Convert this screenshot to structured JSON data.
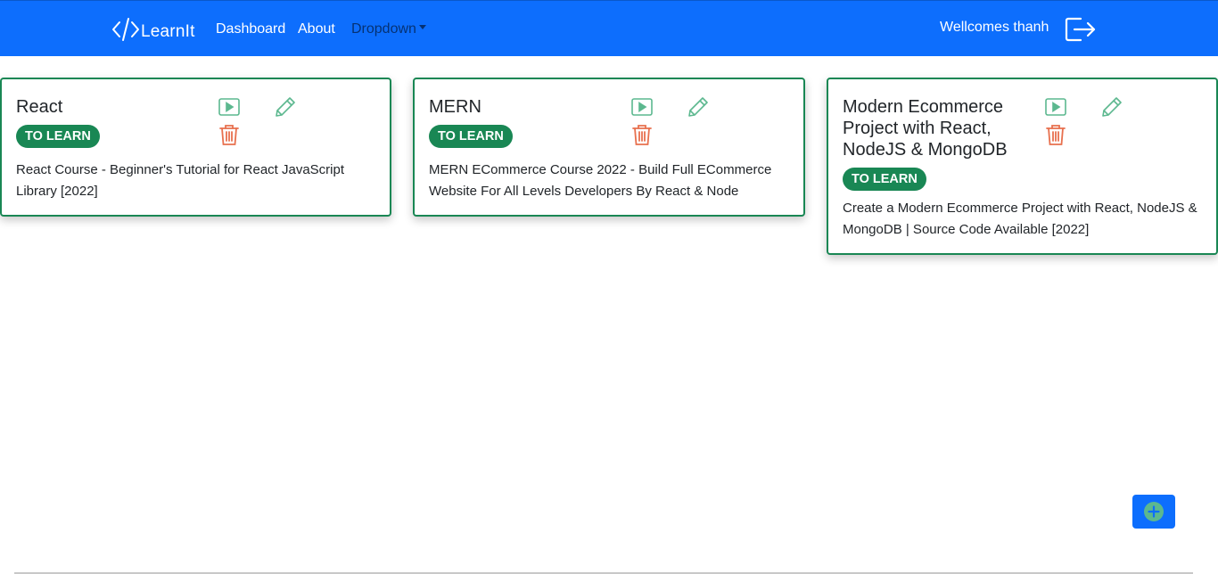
{
  "navbar": {
    "brand": "LearnIt",
    "links": [
      {
        "label": "Dashboard"
      },
      {
        "label": "About"
      },
      {
        "label": "Dropdown"
      }
    ],
    "welcome": "Wellcomes thanh"
  },
  "cards": [
    {
      "title": "React",
      "badge": "TO LEARN",
      "description": "React Course - Beginner's Tutorial for React JavaScript Library [2022]"
    },
    {
      "title": "MERN",
      "badge": "TO LEARN",
      "description": "MERN ECommerce Course 2022 - Build Full ECommerce Website For All Levels Developers By React & Node"
    },
    {
      "title": "Modern Ecommerce Project with React, NodeJS & MongoDB",
      "badge": "TO LEARN",
      "description": "Create a Modern Ecommerce Project with React, NodeJS & MongoDB | Source Code Available [2022]"
    }
  ],
  "colors": {
    "primary": "#0d6efd",
    "success": "#198754",
    "danger": "#e8704e",
    "icon_green": "#5cb88f"
  },
  "icons": [
    "code-icon",
    "logout-icon",
    "play-icon",
    "pencil-icon",
    "trash-icon",
    "plus-circle-icon"
  ]
}
